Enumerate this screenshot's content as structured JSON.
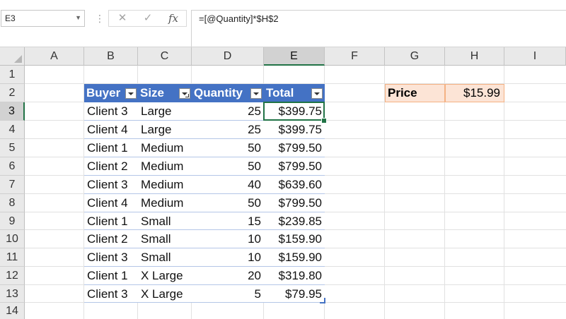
{
  "formula_bar": {
    "name_box": "E3",
    "cancel_icon": "✕",
    "enter_icon": "✓",
    "fx_label": "fx",
    "formula": "=[@Quantity]*$H$2"
  },
  "columns": [
    "A",
    "B",
    "C",
    "D",
    "E",
    "F",
    "G",
    "H",
    "I"
  ],
  "rows": [
    "1",
    "2",
    "3",
    "4",
    "5",
    "6",
    "7",
    "8",
    "9",
    "10",
    "11",
    "12",
    "13",
    "14"
  ],
  "active_cell": {
    "column": "E",
    "row": "3"
  },
  "table": {
    "headers": [
      "Buyer",
      "Size",
      "Quantity",
      "Total"
    ],
    "rows": [
      [
        "Client 3",
        "Large",
        "25",
        "$399.75"
      ],
      [
        "Client 4",
        "Large",
        "25",
        "$399.75"
      ],
      [
        "Client 1",
        "Medium",
        "50",
        "$799.50"
      ],
      [
        "Client 2",
        "Medium",
        "50",
        "$799.50"
      ],
      [
        "Client 3",
        "Medium",
        "40",
        "$639.60"
      ],
      [
        "Client 4",
        "Medium",
        "50",
        "$799.50"
      ],
      [
        "Client 1",
        "Small",
        "15",
        "$239.85"
      ],
      [
        "Client 2",
        "Small",
        "10",
        "$159.90"
      ],
      [
        "Client 3",
        "Small",
        "10",
        "$159.90"
      ],
      [
        "Client 1",
        "X Large",
        "20",
        "$319.80"
      ],
      [
        "Client 3",
        "X Large",
        "5",
        "$79.95"
      ]
    ]
  },
  "price": {
    "label": "Price",
    "value": "$15.99"
  },
  "colors": {
    "table_header": "#4472c4",
    "price_fill": "#fce4d6",
    "selection": "#217346"
  }
}
